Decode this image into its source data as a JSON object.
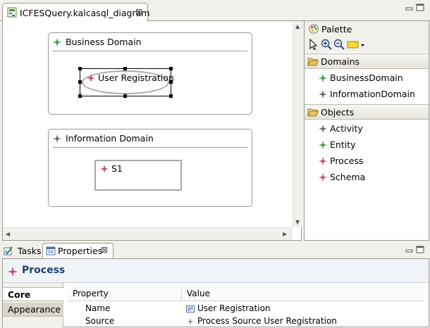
{
  "editor": {
    "tab_title": "ICFESQuery.kalcasql_diagram",
    "tab_close": "⊠"
  },
  "diagram": {
    "business_domain": {
      "title": "Business Domain",
      "process_node": "User Registration"
    },
    "information_domain": {
      "title": "Information Domain",
      "schema_node": "S1"
    }
  },
  "palette": {
    "title": "Palette",
    "drawers": [
      {
        "label": "Domains",
        "items": [
          "BusinessDomain",
          "InformationDomain"
        ]
      },
      {
        "label": "Objects",
        "items": [
          "Activity",
          "Entity",
          "Process",
          "Schema"
        ]
      }
    ]
  },
  "bottom": {
    "tabs": [
      {
        "label": "Tasks"
      },
      {
        "label": "Properties",
        "close": "⊠"
      }
    ]
  },
  "properties": {
    "header": "Process",
    "tabs": [
      "Core",
      "Appearance"
    ],
    "columns": [
      "Property",
      "Value"
    ],
    "rows": [
      {
        "name": "Name",
        "value": "User Registration"
      },
      {
        "name": "Source",
        "value": "Process Source User Registration"
      }
    ]
  },
  "colors": {
    "green_icon": "#3d9a45",
    "pink_icon": "#c0506a",
    "gray_icon": "#6a6a6a",
    "header_text": "#1f3d73",
    "folder": "#e7c35a"
  }
}
